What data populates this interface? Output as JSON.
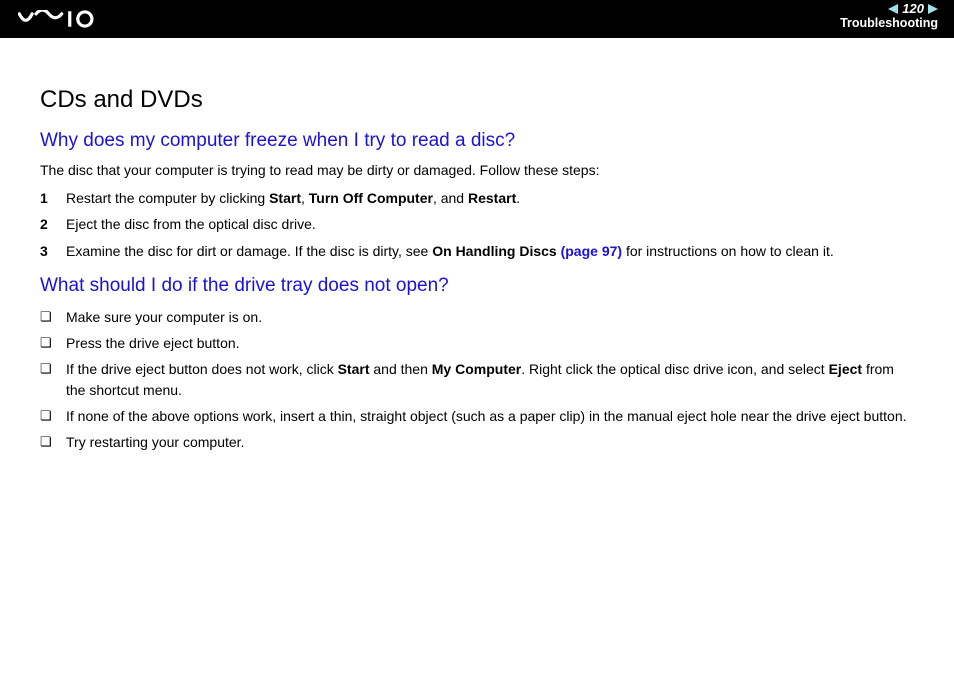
{
  "header": {
    "page_number": "120",
    "section": "Troubleshooting"
  },
  "title": "CDs and DVDs",
  "q1": {
    "heading": "Why does my computer freeze when I try to read a disc?",
    "intro": "The disc that your computer is trying to read may be dirty or damaged. Follow these steps:",
    "steps": [
      {
        "n": "1",
        "pre": "Restart the computer by clicking ",
        "b1": "Start",
        "mid1": ", ",
        "b2": "Turn Off Computer",
        "mid2": ", and ",
        "b3": "Restart",
        "post": "."
      },
      {
        "n": "2",
        "text": "Eject the disc from the optical disc drive."
      },
      {
        "n": "3",
        "pre": "Examine the disc for dirt or damage. If the disc is dirty, see ",
        "b1": "On Handling Discs ",
        "link": "(page 97)",
        "post": " for instructions on how to clean it."
      }
    ]
  },
  "q2": {
    "heading": "What should I do if the drive tray does not open?",
    "items": [
      {
        "text": "Make sure your computer is on."
      },
      {
        "text": "Press the drive eject button."
      },
      {
        "pre": "If the drive eject button does not work, click ",
        "b1": "Start",
        "mid1": " and then ",
        "b2": "My Computer",
        "mid2": ". Right click the optical disc drive icon, and select ",
        "b3": "Eject",
        "post": " from the shortcut menu."
      },
      {
        "text": "If none of the above options work, insert a thin, straight object (such as a paper clip) in the manual eject hole near the drive eject button."
      },
      {
        "text": "Try restarting your computer."
      }
    ]
  }
}
